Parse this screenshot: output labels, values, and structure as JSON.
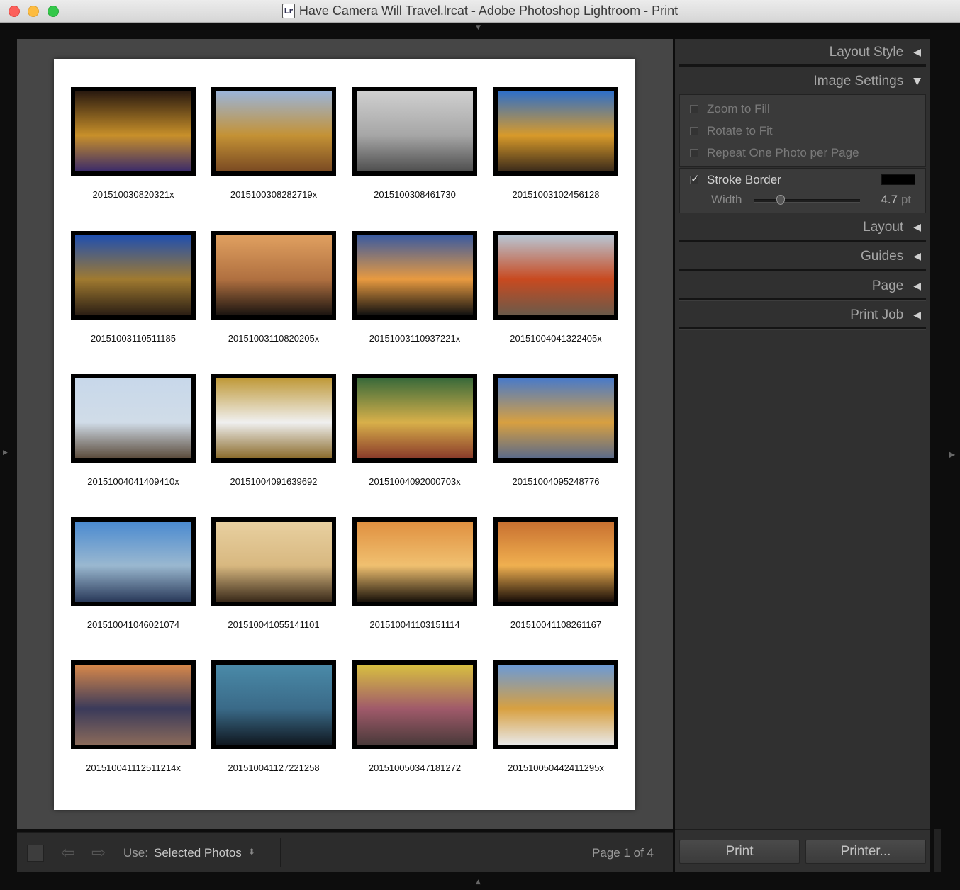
{
  "window": {
    "title": "Have Camera Will Travel.lrcat - Adobe Photoshop Lightroom - Print",
    "doc_icon": "Lr"
  },
  "photos": [
    {
      "caption": "201510030820321x",
      "colors": [
        "#2a1a0f",
        "#c8902a",
        "#3a2a6a"
      ]
    },
    {
      "caption": "2015100308282719x",
      "colors": [
        "#9bb4d8",
        "#c49235",
        "#7a4a22"
      ]
    },
    {
      "caption": "2015100308461730",
      "colors": [
        "#cfcfcf",
        "#a6a6a6",
        "#4e4e4e"
      ]
    },
    {
      "caption": "20151003102456128",
      "colors": [
        "#2f6fc8",
        "#d89a2a",
        "#3a2a1a"
      ]
    },
    {
      "caption": "20151003110511185",
      "colors": [
        "#1f4fb0",
        "#a07a30",
        "#2a1e14"
      ]
    },
    {
      "caption": "20151003110820205x",
      "colors": [
        "#e0a060",
        "#b07040",
        "#1a1410"
      ]
    },
    {
      "caption": "20151003110937221x",
      "colors": [
        "#3a5aa0",
        "#e89a40",
        "#101010"
      ]
    },
    {
      "caption": "20151004041322405x",
      "colors": [
        "#b8c6d4",
        "#c84a20",
        "#6a5a4a"
      ]
    },
    {
      "caption": "20151004041409410x",
      "colors": [
        "#c8d8ea",
        "#d0dce8",
        "#5a4a3a"
      ]
    },
    {
      "caption": "20151004091639692",
      "colors": [
        "#c09a3a",
        "#f0f0f0",
        "#8a6a2a"
      ]
    },
    {
      "caption": "20151004092000703x",
      "colors": [
        "#3a6a3a",
        "#d8b04a",
        "#8a3a2a"
      ]
    },
    {
      "caption": "20151004095248776",
      "colors": [
        "#4a7ac8",
        "#d8a040",
        "#5a6a8a"
      ]
    },
    {
      "caption": "201510041046021074",
      "colors": [
        "#4a8ad0",
        "#9ab8d0",
        "#2a3a5a"
      ]
    },
    {
      "caption": "201510041055141101",
      "colors": [
        "#e8d0a0",
        "#d8b880",
        "#3a2a1a"
      ]
    },
    {
      "caption": "201510041103151114",
      "colors": [
        "#e09040",
        "#f0c070",
        "#1a120a"
      ]
    },
    {
      "caption": "201510041108261167",
      "colors": [
        "#c87030",
        "#f0b050",
        "#1a0e08"
      ]
    },
    {
      "caption": "201510041112511214x",
      "colors": [
        "#d8884a",
        "#3a3a5a",
        "#8a6a5a"
      ]
    },
    {
      "caption": "201510041127221258",
      "colors": [
        "#4a8aa8",
        "#3a6a88",
        "#101820"
      ]
    },
    {
      "caption": "201510050347181272",
      "colors": [
        "#d8c040",
        "#a05a6a",
        "#4a3a3a"
      ]
    },
    {
      "caption": "201510050442411295x",
      "colors": [
        "#6a9ad8",
        "#d8a040",
        "#e8e8e8"
      ]
    }
  ],
  "toolbar": {
    "use_label": "Use:",
    "use_value": "Selected Photos",
    "page_info": "Page 1 of 4",
    "prev_icon": "arrow-left-icon",
    "next_icon": "arrow-right-icon"
  },
  "panel": {
    "layout_style": "Layout Style",
    "image_settings": "Image Settings",
    "zoom_to_fill": "Zoom to Fill",
    "rotate_to_fit": "Rotate to Fit",
    "repeat_one": "Repeat One Photo per Page",
    "stroke_border": "Stroke Border",
    "width_label": "Width",
    "width_value": "4.7",
    "width_unit": "pt",
    "stroke_fraction": 0.25,
    "layout": "Layout",
    "guides": "Guides",
    "page": "Page",
    "print_job": "Print Job",
    "print_button": "Print",
    "printer_button": "Printer..."
  }
}
